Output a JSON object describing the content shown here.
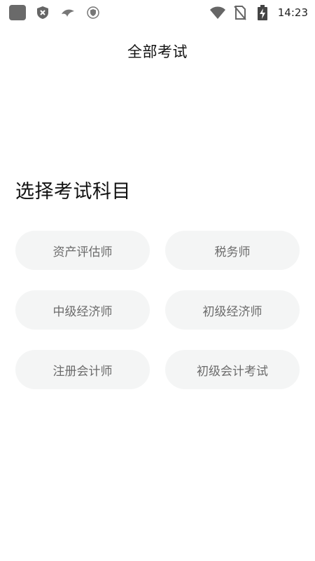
{
  "status_bar": {
    "time": "14:23",
    "left_icons": [
      "app-square-icon",
      "shield-x-icon",
      "bird-logo-icon",
      "shield-badge-icon"
    ],
    "right_icons": [
      "wifi-icon",
      "no-sim-icon",
      "battery-charging-icon"
    ]
  },
  "header": {
    "title": "全部考试"
  },
  "main": {
    "section_title": "选择考试科目",
    "options": [
      {
        "label": "资产评估师"
      },
      {
        "label": "税务师"
      },
      {
        "label": "中级经济师"
      },
      {
        "label": "初级经济师"
      },
      {
        "label": "注册会计师"
      },
      {
        "label": "初级会计考试"
      }
    ]
  },
  "colors": {
    "chip_background": "#f4f5f5",
    "chip_text": "#6b6b6b",
    "text_primary": "#111111"
  }
}
